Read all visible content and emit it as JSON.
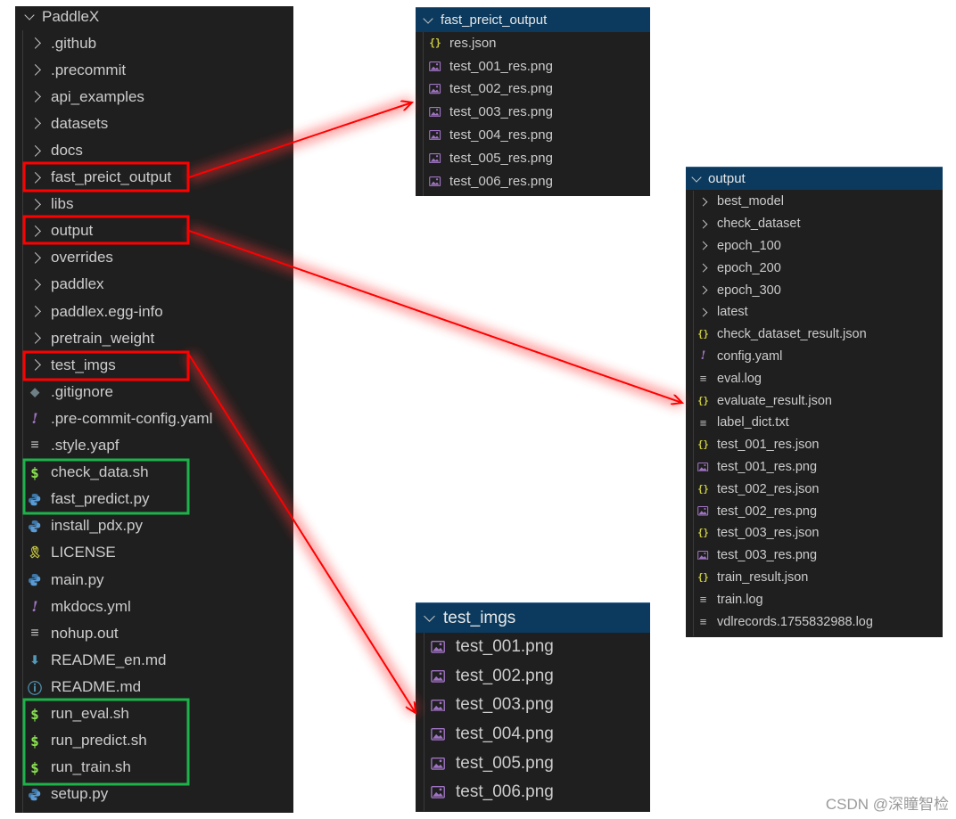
{
  "explorer": {
    "root": "PaddleX",
    "items": [
      {
        "label": ".github",
        "icon": "chevron-right-icon"
      },
      {
        "label": ".precommit",
        "icon": "chevron-right-icon"
      },
      {
        "label": "api_examples",
        "icon": "chevron-right-icon"
      },
      {
        "label": "datasets",
        "icon": "chevron-right-icon"
      },
      {
        "label": "docs",
        "icon": "chevron-right-icon"
      },
      {
        "label": "fast_preict_output",
        "icon": "chevron-right-icon"
      },
      {
        "label": "libs",
        "icon": "chevron-right-icon"
      },
      {
        "label": "output",
        "icon": "chevron-right-icon"
      },
      {
        "label": "overrides",
        "icon": "chevron-right-icon"
      },
      {
        "label": "paddlex",
        "icon": "chevron-right-icon"
      },
      {
        "label": "paddlex.egg-info",
        "icon": "chevron-right-icon"
      },
      {
        "label": "pretrain_weight",
        "icon": "chevron-right-icon"
      },
      {
        "label": "test_imgs",
        "icon": "chevron-right-icon"
      },
      {
        "label": ".gitignore",
        "icon": "git-file-icon"
      },
      {
        "label": ".pre-commit-config.yaml",
        "icon": "yaml-file-icon"
      },
      {
        "label": ".style.yapf",
        "icon": "text-file-icon"
      },
      {
        "label": "check_data.sh",
        "icon": "shell-file-icon"
      },
      {
        "label": "fast_predict.py",
        "icon": "python-file-icon"
      },
      {
        "label": "install_pdx.py",
        "icon": "python-file-icon"
      },
      {
        "label": "LICENSE",
        "icon": "license-icon"
      },
      {
        "label": "main.py",
        "icon": "python-file-icon"
      },
      {
        "label": "mkdocs.yml",
        "icon": "yaml-file-icon"
      },
      {
        "label": "nohup.out",
        "icon": "text-file-icon"
      },
      {
        "label": "README_en.md",
        "icon": "markdown-file-icon"
      },
      {
        "label": "README.md",
        "icon": "info-file-icon"
      },
      {
        "label": "run_eval.sh",
        "icon": "shell-file-icon"
      },
      {
        "label": "run_predict.sh",
        "icon": "shell-file-icon"
      },
      {
        "label": "run_train.sh",
        "icon": "shell-file-icon"
      },
      {
        "label": "setup.py",
        "icon": "python-file-icon"
      }
    ]
  },
  "fast_panel": {
    "title": "fast_preict_output",
    "items": [
      {
        "label": "res.json",
        "icon": "json-file-icon"
      },
      {
        "label": "test_001_res.png",
        "icon": "image-file-icon"
      },
      {
        "label": "test_002_res.png",
        "icon": "image-file-icon"
      },
      {
        "label": "test_003_res.png",
        "icon": "image-file-icon"
      },
      {
        "label": "test_004_res.png",
        "icon": "image-file-icon"
      },
      {
        "label": "test_005_res.png",
        "icon": "image-file-icon"
      },
      {
        "label": "test_006_res.png",
        "icon": "image-file-icon"
      }
    ]
  },
  "output_panel": {
    "title": "output",
    "items": [
      {
        "label": "best_model",
        "icon": "chevron-right-icon"
      },
      {
        "label": "check_dataset",
        "icon": "chevron-right-icon"
      },
      {
        "label": "epoch_100",
        "icon": "chevron-right-icon"
      },
      {
        "label": "epoch_200",
        "icon": "chevron-right-icon"
      },
      {
        "label": "epoch_300",
        "icon": "chevron-right-icon"
      },
      {
        "label": "latest",
        "icon": "chevron-right-icon"
      },
      {
        "label": "check_dataset_result.json",
        "icon": "json-file-icon"
      },
      {
        "label": "config.yaml",
        "icon": "yaml-file-icon"
      },
      {
        "label": "eval.log",
        "icon": "text-file-icon"
      },
      {
        "label": "evaluate_result.json",
        "icon": "json-file-icon"
      },
      {
        "label": "label_dict.txt",
        "icon": "text-file-icon"
      },
      {
        "label": "test_001_res.json",
        "icon": "json-file-icon"
      },
      {
        "label": "test_001_res.png",
        "icon": "image-file-icon"
      },
      {
        "label": "test_002_res.json",
        "icon": "json-file-icon"
      },
      {
        "label": "test_002_res.png",
        "icon": "image-file-icon"
      },
      {
        "label": "test_003_res.json",
        "icon": "json-file-icon"
      },
      {
        "label": "test_003_res.png",
        "icon": "image-file-icon"
      },
      {
        "label": "train_result.json",
        "icon": "json-file-icon"
      },
      {
        "label": "train.log",
        "icon": "text-file-icon"
      },
      {
        "label": "vdlrecords.1755832988.log",
        "icon": "text-file-icon"
      }
    ]
  },
  "imgs_panel": {
    "title": "test_imgs",
    "items": [
      {
        "label": "test_001.png",
        "icon": "image-file-icon"
      },
      {
        "label": "test_002.png",
        "icon": "image-file-icon"
      },
      {
        "label": "test_003.png",
        "icon": "image-file-icon"
      },
      {
        "label": "test_004.png",
        "icon": "image-file-icon"
      },
      {
        "label": "test_005.png",
        "icon": "image-file-icon"
      },
      {
        "label": "test_006.png",
        "icon": "image-file-icon"
      }
    ]
  },
  "colors": {
    "highlight_red": "#ff0000",
    "highlight_green": "#1db34a",
    "panel_bg": "#1f1f1f",
    "header_bg": "#0b3a5e"
  },
  "watermark": "CSDN @深瞳智检"
}
